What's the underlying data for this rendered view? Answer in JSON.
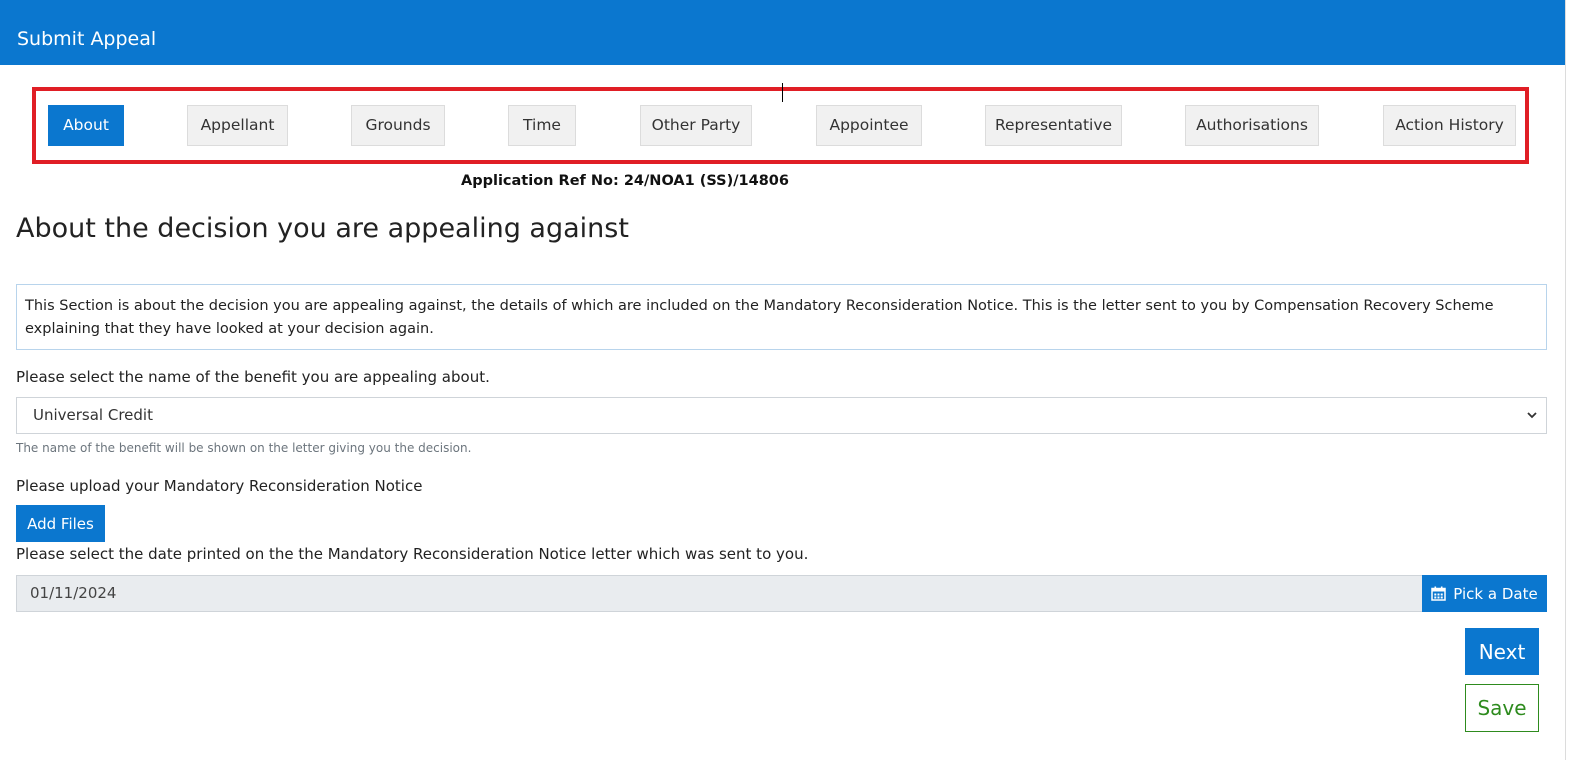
{
  "header": {
    "title": "Submit Appeal"
  },
  "tabs": [
    {
      "label": "About",
      "active": true
    },
    {
      "label": "Appellant"
    },
    {
      "label": "Grounds"
    },
    {
      "label": "Time"
    },
    {
      "label": "Other Party"
    },
    {
      "label": "Appointee"
    },
    {
      "label": "Representative"
    },
    {
      "label": "Authorisations"
    },
    {
      "label": "Action History"
    }
  ],
  "application_ref": "Application Ref No: 24/NOA1 (SS)/14806",
  "page_title": "About the decision you are appealing against",
  "info_text": "This Section is about the decision you are appealing against, the details of which are included on the Mandatory Reconsideration Notice. This is the letter sent to you by Compensation Recovery Scheme explaining that they have looked at your decision again.",
  "benefit": {
    "label": "Please select the name of the benefit you are appealing about.",
    "selected": "Universal Credit",
    "hint": "The name of the benefit will be shown on the letter giving you the decision."
  },
  "upload": {
    "label": "Please upload your Mandatory Reconsideration Notice",
    "button": "Add Files"
  },
  "date": {
    "label": "Please select the date printed on the the Mandatory Reconsideration Notice letter which was sent to you.",
    "value": "01/11/2024",
    "button": "Pick a Date"
  },
  "actions": {
    "next": "Next",
    "save": "Save"
  },
  "colors": {
    "primary": "#0b77cf",
    "highlight_frame": "#e01e25",
    "save": "#2e8b1e"
  }
}
